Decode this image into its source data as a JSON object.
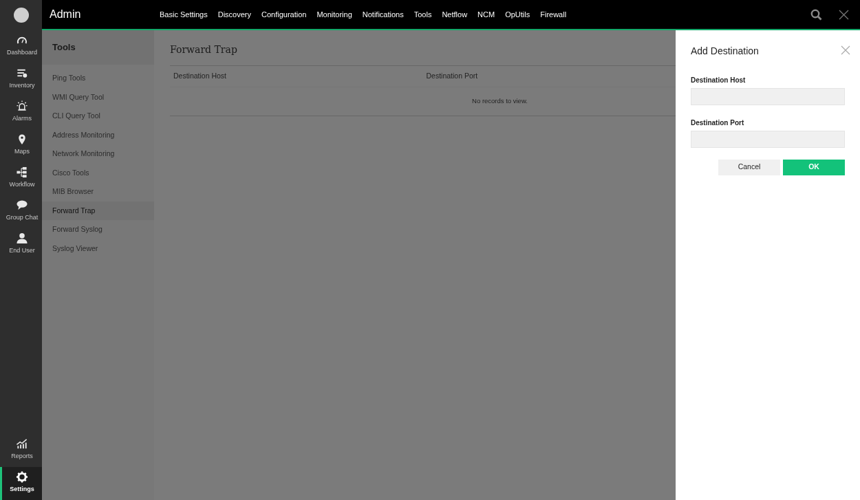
{
  "app": {
    "title": "Admin"
  },
  "rail": {
    "items": [
      {
        "label": "Dashboard",
        "selected": false
      },
      {
        "label": "Inventory",
        "selected": false
      },
      {
        "label": "Alarms",
        "selected": false
      },
      {
        "label": "Maps",
        "selected": false
      },
      {
        "label": "Workflow",
        "selected": false
      },
      {
        "label": "Group Chat",
        "selected": false
      },
      {
        "label": "End User",
        "selected": false
      }
    ],
    "bottom_items": [
      {
        "label": "Reports",
        "selected": false
      },
      {
        "label": "Settings",
        "selected": true
      }
    ]
  },
  "top_nav": [
    "Basic Settings",
    "Discovery",
    "Configuration",
    "Monitoring",
    "Notifications",
    "Tools",
    "Netflow",
    "NCM",
    "OpUtils",
    "Firewall"
  ],
  "tools_panel": {
    "title": "Tools",
    "items": [
      {
        "label": "Ping Tools",
        "selected": false
      },
      {
        "label": "WMI Query Tool",
        "selected": false
      },
      {
        "label": "CLI Query Tool",
        "selected": false
      },
      {
        "label": "Address Monitoring",
        "selected": false
      },
      {
        "label": "Network Monitoring",
        "selected": false
      },
      {
        "label": "Cisco Tools",
        "selected": false
      },
      {
        "label": "MIB Browser",
        "selected": false
      },
      {
        "label": "Forward Trap",
        "selected": true
      },
      {
        "label": "Forward Syslog",
        "selected": false
      },
      {
        "label": "Syslog Viewer",
        "selected": false
      }
    ]
  },
  "page": {
    "title": "Forward Trap",
    "table": {
      "columns": [
        "Destination Host",
        "Destination Port"
      ],
      "empty_text": "No records to view."
    }
  },
  "drawer": {
    "title": "Add Destination",
    "fields": [
      {
        "label": "Destination Host"
      },
      {
        "label": "Destination Port"
      }
    ],
    "buttons": [
      {
        "label": "Cancel",
        "kind": "secondary"
      },
      {
        "label": "OK",
        "kind": "primary"
      }
    ]
  }
}
